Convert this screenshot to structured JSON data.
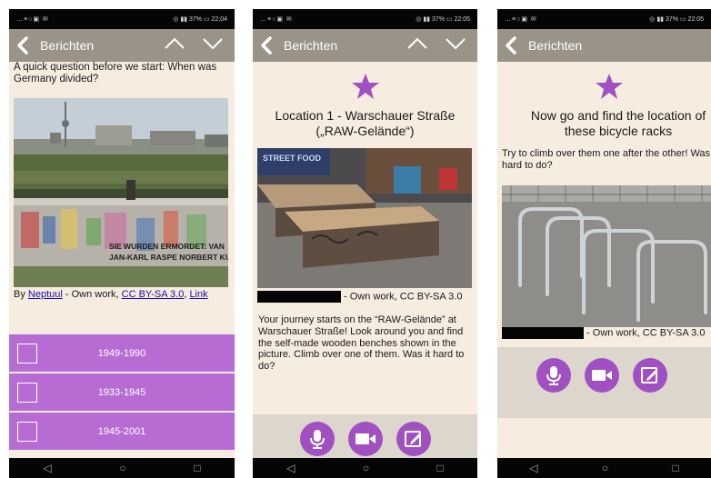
{
  "status_bar": {
    "left": "…≡○▣ ✉",
    "screen1_right": "◎ ▮▮ 37% ▭ 22:04",
    "screen2_right": "◎ ▮▮ 37% ▭ 22:05",
    "screen3_right": "◎ ▮▮ 37% ▭ 22:05"
  },
  "header": {
    "title": "Berichten"
  },
  "screen1": {
    "question": "A quick question before we start: When was Germany divided?",
    "credit": {
      "prefix": "By ",
      "author": "Neptuul",
      "middle": " - Own work, ",
      "license": "CC BY-SA 3.0",
      "sep": ", ",
      "link": "Link"
    },
    "graffiti": [
      "SIE WURDEN ERMORDET: VAN",
      "JAN-KARL RASPE NORBERT KU"
    ],
    "options": [
      {
        "label": "1949-1990"
      },
      {
        "label": "1933-1945"
      },
      {
        "label": "1945-2001"
      }
    ]
  },
  "screen2": {
    "title_line1": "Location 1 - Warschauer Straße",
    "title_line2": "(„RAW-Gelände“)",
    "photo_sign": "STREET FOOD",
    "credit": " - Own work, CC BY-SA 3.0",
    "body": "Your journey starts on the “RAW-Gelände” at Warschauer Straße! Look around you and find the self-made wooden benches shown in the picture. Climb over one of them. Was it hard to do?"
  },
  "screen3": {
    "title_line1": "Now go and find the location of",
    "title_line2": "these bicycle racks",
    "body": "Try to climb over them one after the other! Was it hard to do?",
    "credit": " - Own work, CC BY-SA 3.0"
  },
  "colors": {
    "appbar": "#9a9488",
    "accent": "#b66cd3",
    "background": "#f6ece0"
  },
  "icons": [
    "back-arrow-icon",
    "chevron-up-icon",
    "chevron-down-icon",
    "star-icon",
    "microphone-icon",
    "video-camera-icon",
    "edit-icon",
    "nav-back-icon",
    "nav-home-icon",
    "nav-recents-icon"
  ]
}
